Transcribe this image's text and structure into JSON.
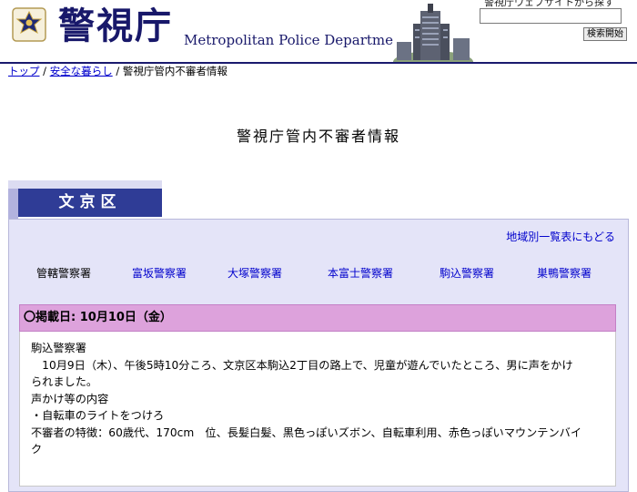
{
  "header": {
    "logo_ja": "警視庁",
    "logo_en": "Metropolitan Police Department",
    "search_caption": "警視庁ウェブサイトから探す",
    "search_value": "",
    "search_button": "検索開始"
  },
  "breadcrumb": {
    "items": [
      "トップ",
      "安全な暮らし"
    ],
    "current": "警視庁管内不審者情報",
    "separator": "/"
  },
  "page_title": "警視庁管内不審者情報",
  "ward_tab": "文京区",
  "back_link": "地域別一覧表にもどる",
  "stations": [
    "管轄警察署",
    "富坂警察署",
    "大塚警察署",
    "本富士警察署",
    "駒込警察署",
    "巣鴨警察署"
  ],
  "report": {
    "date_label": "〇掲載日:  10月10日（金）",
    "lines": [
      "駒込警察署",
      "　10月9日（木）、午後5時10分ころ、文京区本駒込2丁目の路上で、児童が遊んでいたところ、男に声をかけ",
      "られました。",
      "声かけ等の内容",
      "・自転車のライトをつけろ",
      "不審者の特徴：60歳代、170cm　位、長髪白髪、黒色っぽいズボン、自転車利用、赤色っぽいマウンテンバイ",
      "ク"
    ]
  },
  "colors": {
    "brand_navy": "#18186a",
    "tab_blue": "#2f3c96",
    "panel_bg": "#e4e4f8",
    "date_bar": "#dda2dc",
    "link": "#0000cc"
  }
}
